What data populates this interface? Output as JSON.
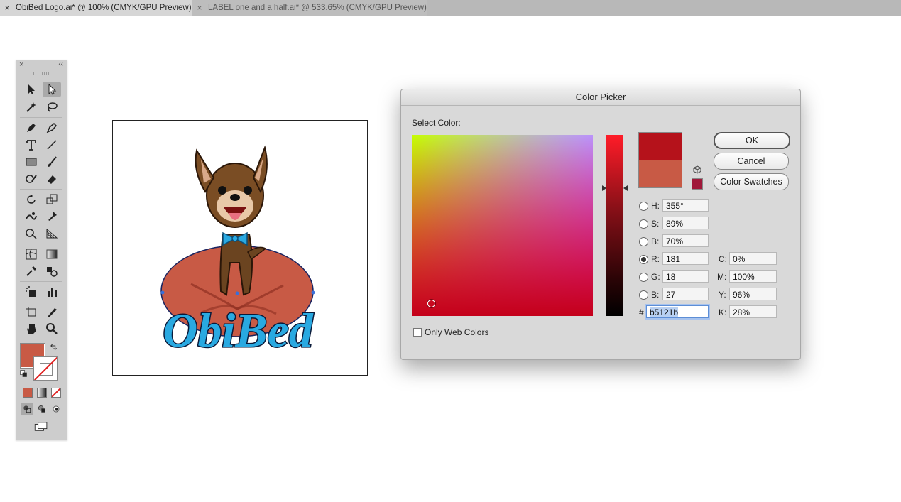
{
  "tabs": [
    {
      "label": "ObiBed Logo.ai* @ 100% (CMYK/GPU Preview)",
      "close": "×"
    },
    {
      "label": "LABEL one and a half.ai* @ 533.65% (CMYK/GPU Preview)",
      "close": "×"
    }
  ],
  "toolbox": {
    "close": "×",
    "collapse": "‹‹",
    "fill_color": "#c85a45"
  },
  "artwork": {
    "logo_text": "ObiBed",
    "cushion_color": "#c85a45",
    "text_color": "#29a9e1",
    "bowtie_color": "#29a9e1"
  },
  "color_picker": {
    "title": "Color Picker",
    "select_label": "Select Color:",
    "new_color": "#b5121b",
    "original_color": "#c85a45",
    "web_safe_color": "#a0183a",
    "ok_label": "OK",
    "cancel_label": "Cancel",
    "swatches_label": "Color Swatches",
    "hsb": {
      "h_label": "H:",
      "h_value": "355°",
      "s_label": "S:",
      "s_value": "89%",
      "b_label": "B:",
      "b_value": "70%"
    },
    "rgb": {
      "r_label": "R:",
      "r_value": "181",
      "g_label": "G:",
      "g_value": "18",
      "b_label": "B:",
      "b_value": "27"
    },
    "hex_label": "#",
    "hex_value": "b5121b",
    "cmyk": {
      "c_label": "C:",
      "c_value": "0%",
      "m_label": "M:",
      "m_value": "100%",
      "y_label": "Y:",
      "y_value": "96%",
      "k_label": "K:",
      "k_value": "28%"
    },
    "only_web_colors_label": "Only Web Colors",
    "only_web_colors_checked": false,
    "selected_mode": "R"
  }
}
